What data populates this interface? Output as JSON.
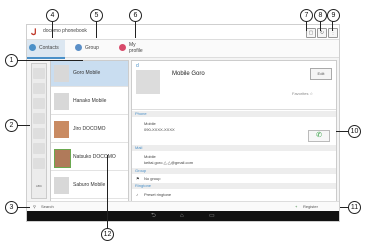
{
  "app": {
    "name": "docomo phonebook"
  },
  "tabs": [
    {
      "label": "Contacts"
    },
    {
      "label": "Group"
    },
    {
      "label": "My profile"
    }
  ],
  "index": {
    "label": "ABC"
  },
  "contacts": [
    {
      "name": "Goro Mobile",
      "selected": true
    },
    {
      "name": "Hanako Mobile",
      "selected": false
    },
    {
      "name": "Jiro DOCOMO",
      "selected": false
    },
    {
      "name": "Natsuko DOCOMO",
      "selected": false
    },
    {
      "name": "Saburo Mobile",
      "selected": false
    }
  ],
  "detail": {
    "letter": "d",
    "name": "Mobile Goro",
    "edit": "Edit",
    "favorites": "Favorites ☆",
    "phone_header": "Phone",
    "phone_type": "Mobile",
    "phone_number": "090-XXXX-XXXX",
    "mail_header": "Mail",
    "mail_type": "Mobile",
    "mail_value": "keitai.goro.△.△@gmail.com",
    "group_header": "Group",
    "group_value": "No group",
    "ringtone_header": "Ringtone",
    "ringtone_value": "Preset ringtone"
  },
  "bottom": {
    "search": "Search",
    "register": "Register"
  },
  "callouts": [
    "1",
    "2",
    "3",
    "4",
    "5",
    "6",
    "7",
    "8",
    "9",
    "10",
    "11",
    "12"
  ]
}
